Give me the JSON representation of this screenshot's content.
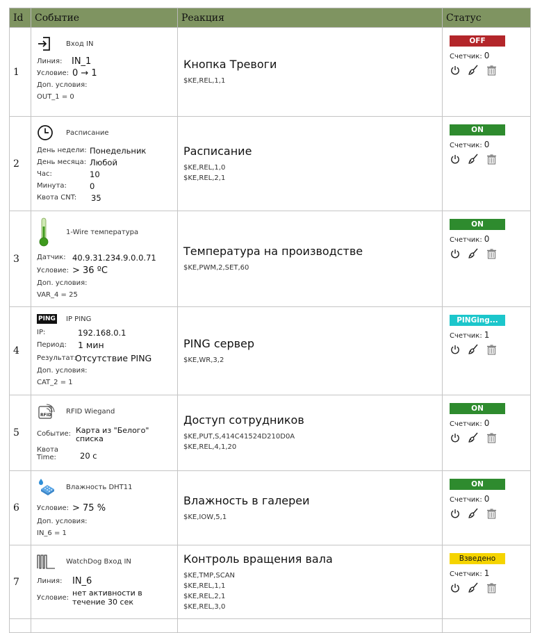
{
  "header": {
    "id": "Id",
    "event": "Событие",
    "reaction": "Реакция",
    "status": "Статус"
  },
  "colors": {
    "header_bg": "#7f9461",
    "off": "#b3262a",
    "on": "#2e8b2e",
    "pinging": "#1cc6cb",
    "armed": "#f5d400"
  },
  "counter_label": "Счетчик:",
  "rows": [
    {
      "id": "1",
      "event": {
        "name": "Вход IN",
        "icon": "login-icon",
        "p1_label": "Линия:",
        "p1_value": "IN_1",
        "p2_label": "Условие:",
        "p2_value": "0 → 1",
        "extra_label": "Доп. условия:",
        "extra_value": "OUT_1 = 0"
      },
      "reaction": {
        "title": "Кнопка Тревоги",
        "c1": "$KE,REL,1,1"
      },
      "status": {
        "badge": "OFF",
        "badge_color": "#b3262a",
        "counter": "0"
      }
    },
    {
      "id": "2",
      "event": {
        "name": "Расписание",
        "icon": "clock-icon",
        "p1_label": "День недели:",
        "p1_value": "Понедельник",
        "p2_label": "День месяца:",
        "p2_value": "Любой",
        "p3_label": "Час:",
        "p3_value": "10",
        "p4_label": "Минута:",
        "p4_value": "0",
        "p5_label": "Квота CNT:",
        "p5_value": "35"
      },
      "reaction": {
        "title": "Расписание",
        "c1": "$KE,REL,1,0",
        "c2": "$KE,REL,2,1"
      },
      "status": {
        "badge": "ON",
        "badge_color": "#2e8b2e",
        "counter": "0"
      }
    },
    {
      "id": "3",
      "event": {
        "name": "1-Wire температура",
        "icon": "thermometer-icon",
        "p1_label": "Датчик:",
        "p1_value": "40.9.31.234.9.0.0.71",
        "p2_label": "Условие:",
        "p2_value": "> 36 ºC",
        "extra_label": "Доп. условия:",
        "extra_value": "VAR_4 = 25"
      },
      "reaction": {
        "title": "Температура на производстве",
        "c1": "$KE,PWM,2,SET,60"
      },
      "status": {
        "badge": "ON",
        "badge_color": "#2e8b2e",
        "counter": "0"
      }
    },
    {
      "id": "4",
      "event": {
        "name": "IP PING",
        "icon": "ping-icon",
        "icon_text": "PING",
        "p1_label": "IP:",
        "p1_value": "192.168.0.1",
        "p2_label": "Период:",
        "p2_value": "1 мин",
        "p3_label": "Результат:",
        "p3_value": "Отсутствие PING",
        "extra_label": "Доп. условия:",
        "extra_value": "CAT_2 = 1"
      },
      "reaction": {
        "title": "PING сервер",
        "c1": "$KE,WR,3,2"
      },
      "status": {
        "badge": "PINGing...",
        "badge_color": "#1cc6cb",
        "counter": "1"
      }
    },
    {
      "id": "5",
      "event": {
        "name": "RFID Wiegand",
        "icon": "rfid-icon",
        "icon_text": "RFID",
        "p1_label": "Событие:",
        "p1_value": "Карта из \"Белого\" списка",
        "p2_label": "Квота Time:",
        "p2_value": "20 с"
      },
      "reaction": {
        "title": "Доступ сотрудников",
        "c1": "$KE,PUT,S,414C41524D210D0A",
        "c2": "$KE,REL,4,1,20"
      },
      "status": {
        "badge": "ON",
        "badge_color": "#2e8b2e",
        "counter": "0"
      }
    },
    {
      "id": "6",
      "event": {
        "name": "Влажность DHT11",
        "icon": "humidity-sensor-icon",
        "p1_label": "Условие:",
        "p1_value": "> 75 %",
        "extra_label": "Доп. условия:",
        "extra_value": "IN_6 = 1"
      },
      "reaction": {
        "title": "Влажность в галереи",
        "c1": "$KE,IOW,5,1"
      },
      "status": {
        "badge": "ON",
        "badge_color": "#2e8b2e",
        "counter": "0"
      }
    },
    {
      "id": "7",
      "event": {
        "name": "WatchDog Вход IN",
        "icon": "watchdog-pulse-icon",
        "p1_label": "Линия:",
        "p1_value": "IN_6",
        "p2_label": "Условие:",
        "p2_value": "нет активности в течение 30 сек"
      },
      "reaction": {
        "title": "Контроль вращения вала",
        "c1": "$KE,TMP,SCAN",
        "c2": "$KE,REL,1,1",
        "c3": "$KE,REL,2,1",
        "c4": "$KE,REL,3,0"
      },
      "status": {
        "badge": "Взведено",
        "badge_color": "#f5d400",
        "badge_text_color": "#111",
        "counter": "1"
      }
    }
  ]
}
